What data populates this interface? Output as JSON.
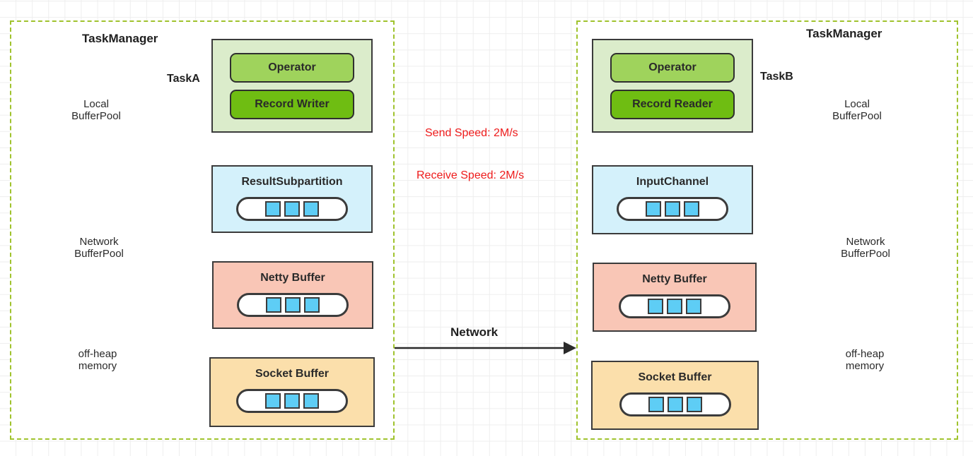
{
  "diagram": {
    "title": "Flink network stack data transfer between two TaskManagers",
    "accent_border_color": "#a0c32e",
    "speed_text_color": "#ee1b1b",
    "chip_color": "#5ecdf5"
  },
  "left": {
    "taskmanager_label": "TaskManager",
    "task_label": "TaskA",
    "operator_group": {
      "operator": "Operator",
      "record": "Record Writer"
    },
    "boxes": [
      {
        "title": "ResultSubpartition",
        "color": "#d4f1fb",
        "chips": 3
      },
      {
        "title": "Netty Buffer",
        "color": "#f9c6b6",
        "chips": 3
      },
      {
        "title": "Socket Buffer",
        "color": "#fbdfab",
        "chips": 3
      }
    ],
    "local_buffer_pool": {
      "line1": "Local",
      "line2": "BufferPool"
    },
    "network_buffer_pool": {
      "line1": "Network",
      "line2": "BufferPool"
    },
    "off_heap": {
      "line1": "off-heap",
      "line2": "memory"
    }
  },
  "right": {
    "taskmanager_label": "TaskManager",
    "task_label": "TaskB",
    "operator_group": {
      "operator": "Operator",
      "record": "Record Reader"
    },
    "boxes": [
      {
        "title": "InputChannel",
        "color": "#d4f1fb",
        "chips": 3
      },
      {
        "title": "Netty Buffer",
        "color": "#f9c6b6",
        "chips": 3
      },
      {
        "title": "Socket Buffer",
        "color": "#fbdfab",
        "chips": 3
      }
    ],
    "local_buffer_pool": {
      "line1": "Local",
      "line2": "BufferPool"
    },
    "network_buffer_pool": {
      "line1": "Network",
      "line2": "BufferPool"
    },
    "off_heap": {
      "line1": "off-heap",
      "line2": "memory"
    }
  },
  "middle": {
    "send_speed": "Send Speed: 2M/s",
    "receive_speed": "Receive Speed: 2M/s",
    "network_label": "Network"
  }
}
